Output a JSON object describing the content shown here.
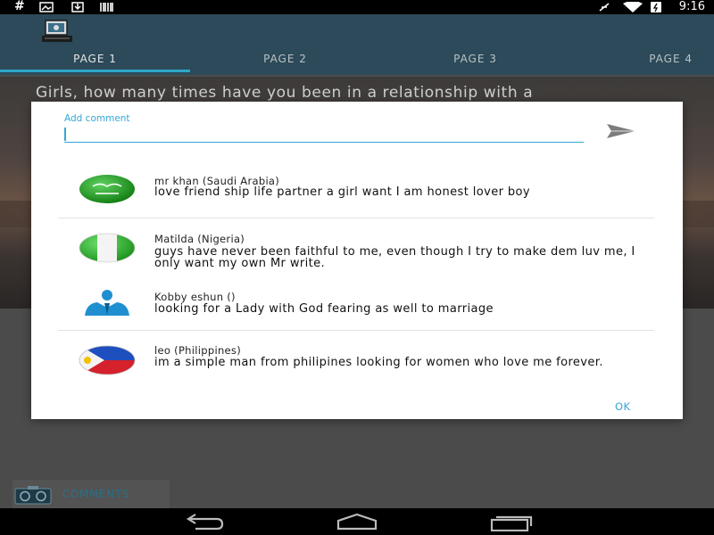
{
  "status_bar": {
    "left_glyph": "#",
    "icons": [
      "hash-icon",
      "image-notification-icon",
      "download-icon",
      "barcode-icon",
      "airplane-mute-icon",
      "wifi-icon",
      "battery-icon"
    ],
    "time": "9:16"
  },
  "app": {
    "logo_icon": "computer-logo-icon",
    "tabs": [
      {
        "label": "PAGE 1",
        "active": true
      },
      {
        "label": "PAGE 2",
        "active": false
      },
      {
        "label": "PAGE 3",
        "active": false
      },
      {
        "label": "PAGE 4",
        "active": false
      }
    ],
    "accent_color": "#2ea7c7"
  },
  "background": {
    "headline": "Girls, how many times have you been in a relationship with a",
    "comments_button_label": "COMMENTS"
  },
  "dialog": {
    "input_label": "Add comment",
    "input_value": "",
    "send_icon": "send-icon",
    "ok_label": "OK",
    "comments": [
      {
        "author": "mr khan (Saudi Arabia)",
        "avatar": "saudi-arabia-flag-icon",
        "text": "love friend ship life partner a girl want  I am honest lover boy"
      },
      {
        "author": "Matilda  (Nigeria)",
        "avatar": "nigeria-flag-icon",
        "text": "guys have never been faithful to me, even though I try to make dem luv me, I only want my own Mr write."
      },
      {
        "author": "Kobby eshun ()",
        "avatar": "person-icon",
        "text": "looking for a Lady with God fearing as well to marriage"
      },
      {
        "author": "leo (Philippines)",
        "avatar": "philippines-flag-icon",
        "text": "im a simple man from philipines looking for women who love me forever."
      }
    ]
  },
  "nav_bar": {
    "icons": [
      "back-icon",
      "home-icon",
      "recents-icon"
    ]
  }
}
